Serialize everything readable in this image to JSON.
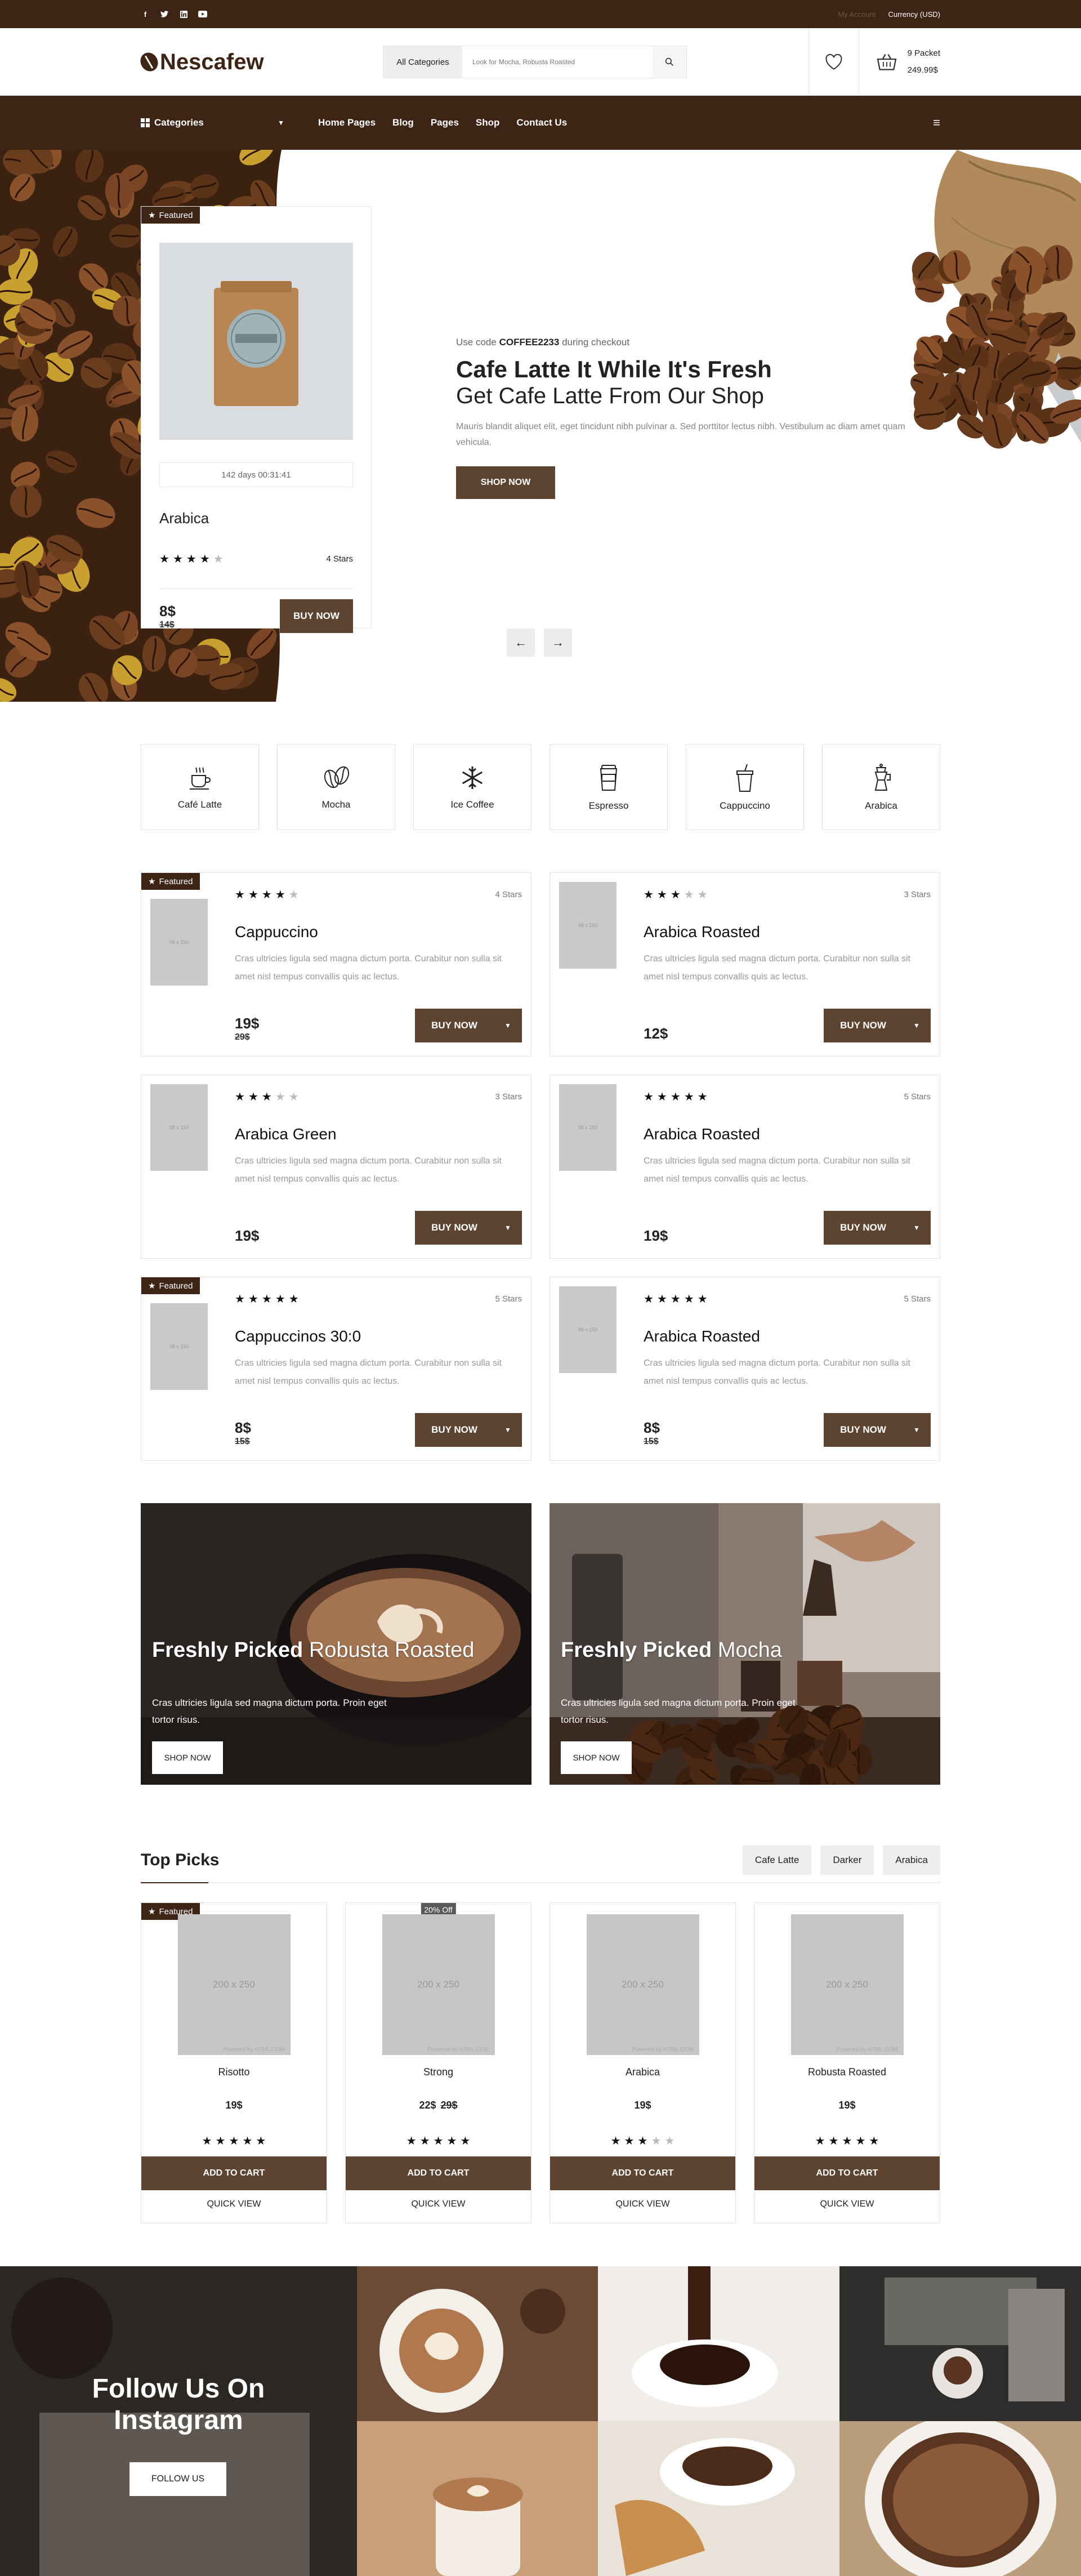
{
  "topbar": {
    "social": [
      "facebook-icon",
      "twitter-icon",
      "linkedin-icon",
      "youtube-icon"
    ],
    "my_account": "My Account",
    "currency": "Currency (USD)"
  },
  "header": {
    "logo": "Nescafew",
    "search_category": "All Categories",
    "search_placeholder": "Look for Mocha, Robusta Roasted",
    "cart_count": "9 Packet",
    "cart_total": "249.99$"
  },
  "nav": {
    "categories": "Categories",
    "links": [
      "Home Pages",
      "Blog",
      "Pages",
      "Shop",
      "Contact Us"
    ]
  },
  "hero": {
    "featured_badge": "Featured",
    "countdown": "142 days 00:31:41",
    "product_name": "Arabica",
    "stars_label": "4 Stars",
    "stars": 4,
    "price": "8$",
    "old_price": "14$",
    "buy_label": "BUY NOW",
    "code_prefix": "Use code",
    "code": "COFFEE2233",
    "code_suffix": "during checkout",
    "title": "Cafe Latte It While It's Fresh",
    "subtitle": "Get Cafe Latte From Our Shop",
    "text": "Mauris blandit aliquet elit, eget tincidunt nibh pulvinar a. Sed porttitor lectus nibh. Vestibulum ac diam amet quam vehicula.",
    "shop_label": "SHOP NOW"
  },
  "categories": [
    {
      "icon": "coffee-cup-icon",
      "label": "Café Latte"
    },
    {
      "icon": "coffee-bean-icon",
      "label": "Mocha"
    },
    {
      "icon": "snowflake-icon",
      "label": "Ice Coffee"
    },
    {
      "icon": "espresso-cup-icon",
      "label": "Espresso"
    },
    {
      "icon": "takeaway-cup-icon",
      "label": "Cappuccino"
    },
    {
      "icon": "moka-pot-icon",
      "label": "Arabica"
    }
  ],
  "products": [
    {
      "name": "Cappuccino",
      "stars": 4,
      "stars_label": "4 Stars",
      "price": "19$",
      "old_price": "29$",
      "featured": true
    },
    {
      "name": "Arabica Roasted",
      "stars": 3,
      "stars_label": "3 Stars",
      "price": "12$",
      "old_price": "",
      "featured": false
    },
    {
      "name": "Arabica Green",
      "stars": 3,
      "stars_label": "3 Stars",
      "price": "19$",
      "old_price": "",
      "featured": false
    },
    {
      "name": "Arabica Roasted",
      "stars": 5,
      "stars_label": "5 Stars",
      "price": "19$",
      "old_price": "",
      "featured": false
    },
    {
      "name": "Cappuccinos 30:0",
      "stars": 5,
      "stars_label": "5 Stars",
      "price": "8$",
      "old_price": "15$",
      "featured": true
    },
    {
      "name": "Arabica Roasted",
      "stars": 5,
      "stars_label": "5 Stars",
      "price": "8$",
      "old_price": "15$",
      "featured": false
    }
  ],
  "product_common": {
    "description": "Cras ultricies ligula sed magna dictum porta. Curabitur non sulla sit amet nisl tempus convallis quis ac lectus.",
    "thumb_text": "98 x 150",
    "buy_label": "BUY NOW",
    "featured_label": "Featured"
  },
  "banners": [
    {
      "bold": "Freshly Picked",
      "light": "Robusta Roasted",
      "text": "Cras ultricies ligula sed magna dictum porta. Proin eget tortor risus.",
      "button": "SHOP NOW"
    },
    {
      "bold": "Freshly Picked",
      "light": "Mocha",
      "text": "Cras ultricies ligula sed magna dictum porta. Proin eget tortor risus.",
      "button": "SHOP NOW"
    }
  ],
  "top_picks": {
    "title": "Top Picks",
    "tabs": [
      "Cafe Latte",
      "Darker",
      "Arabica"
    ],
    "placeholder": "200 x 250",
    "powered": "Powered by HTML.COM",
    "add_to_cart": "ADD TO CART",
    "quick_view": "QUICK VIEW",
    "featured_label": "Featured",
    "items": [
      {
        "name": "Risotto",
        "price": "19$",
        "old_price": "",
        "stars": 5,
        "badge": "featured"
      },
      {
        "name": "Strong",
        "price": "22$",
        "old_price": "29$",
        "stars": 5,
        "badge": "20% Off"
      },
      {
        "name": "Arabica",
        "price": "19$",
        "old_price": "",
        "stars": 3,
        "badge": ""
      },
      {
        "name": "Robusta Roasted",
        "price": "19$",
        "old_price": "",
        "stars": 5,
        "badge": ""
      }
    ]
  },
  "instagram": {
    "title_line1": "Follow Us On",
    "title_line2": "Instagram",
    "button": "FOLLOW US"
  },
  "colors": {
    "brand": "#3d2414",
    "button": "#5c4430"
  }
}
